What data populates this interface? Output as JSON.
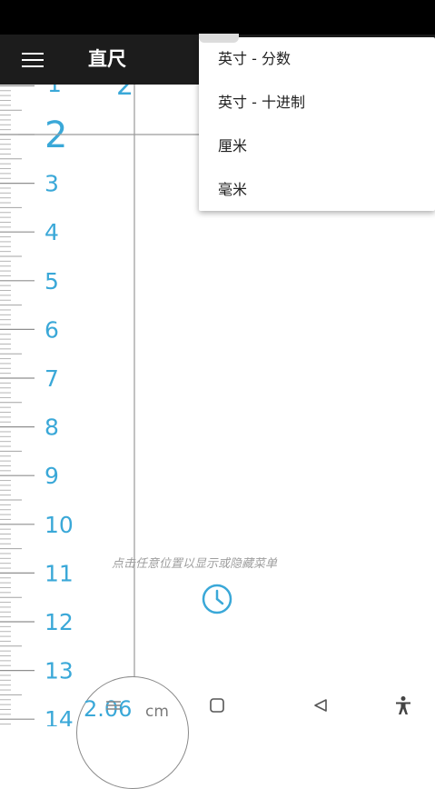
{
  "app_bar": {
    "title": "直尺",
    "menu_icon": "hamburger-menu-icon"
  },
  "ruler": {
    "major_labels": [
      "2",
      "3",
      "4",
      "5",
      "6",
      "7",
      "8",
      "9",
      "10",
      "11",
      "12",
      "13",
      "14"
    ],
    "top_partial_label": "1",
    "crosshair_label": "2",
    "accent_color": "#3aa8d8"
  },
  "hint": {
    "text": "点击任意位置以显示或隐藏菜单"
  },
  "clock_icon": "clock-icon",
  "measurement": {
    "value": "2.06",
    "unit": "cm"
  },
  "nav_bar": {
    "icons": [
      "recents-icon",
      "home-icon",
      "back-icon",
      "accessibility-icon"
    ]
  },
  "unit_menu": {
    "items": [
      {
        "label": "英寸 - 分数"
      },
      {
        "label": "英寸 - 十进制"
      },
      {
        "label": "厘米"
      },
      {
        "label": "毫米"
      }
    ]
  }
}
